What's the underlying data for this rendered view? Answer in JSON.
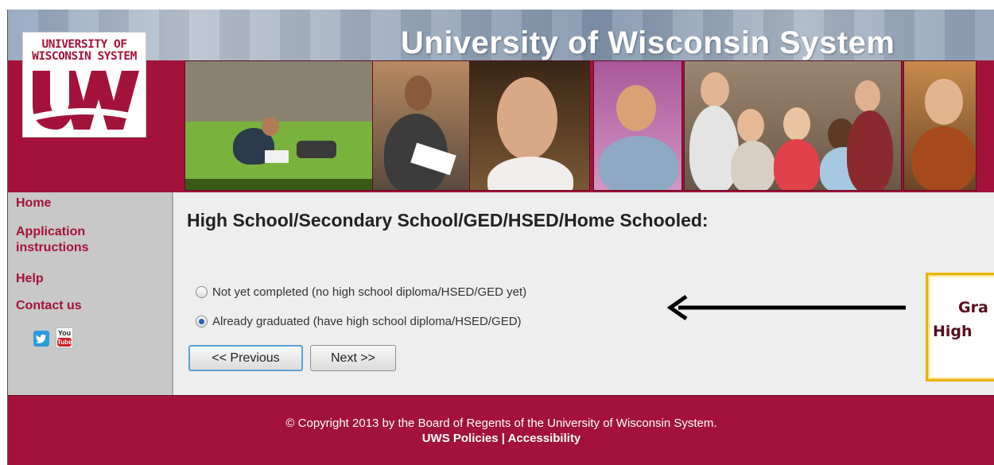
{
  "header": {
    "site_title": "University of Wisconsin System",
    "logo_line1": "UNIVERSITY OF",
    "logo_line2": "WISCONSIN SYSTEM",
    "logo_mark": "UW"
  },
  "sidebar": {
    "items": [
      {
        "label": "Home"
      },
      {
        "label": "Application instructions"
      },
      {
        "label": "Help"
      },
      {
        "label": "Contact us"
      }
    ],
    "social": [
      {
        "icon": "twitter-icon"
      },
      {
        "icon": "youtube-icon",
        "label_top": "You",
        "label_bottom": "Tube"
      }
    ]
  },
  "main": {
    "title": "High School/Secondary School/GED/HSED/Home Schooled:",
    "options": [
      {
        "label": "Not yet completed (no high school diploma/HSED/GED yet)",
        "checked": false
      },
      {
        "label": "Already graduated (have high school diploma/HSED/GED)",
        "checked": true
      }
    ],
    "previous_label": "<< Previous",
    "next_label": "Next >>"
  },
  "annotation": {
    "line1": "Gra",
    "line2": "High"
  },
  "footer": {
    "copyright": "© Copyright 2013 by the Board of Regents of the University of Wisconsin System.",
    "policies": "UWS Policies",
    "separator": " | ",
    "accessibility": "Accessibility"
  },
  "colors": {
    "brand": "#a3123a",
    "sidebar_bg": "#c8c8c8",
    "content_bg": "#eeeeee",
    "callout_border": "#e8b400"
  }
}
